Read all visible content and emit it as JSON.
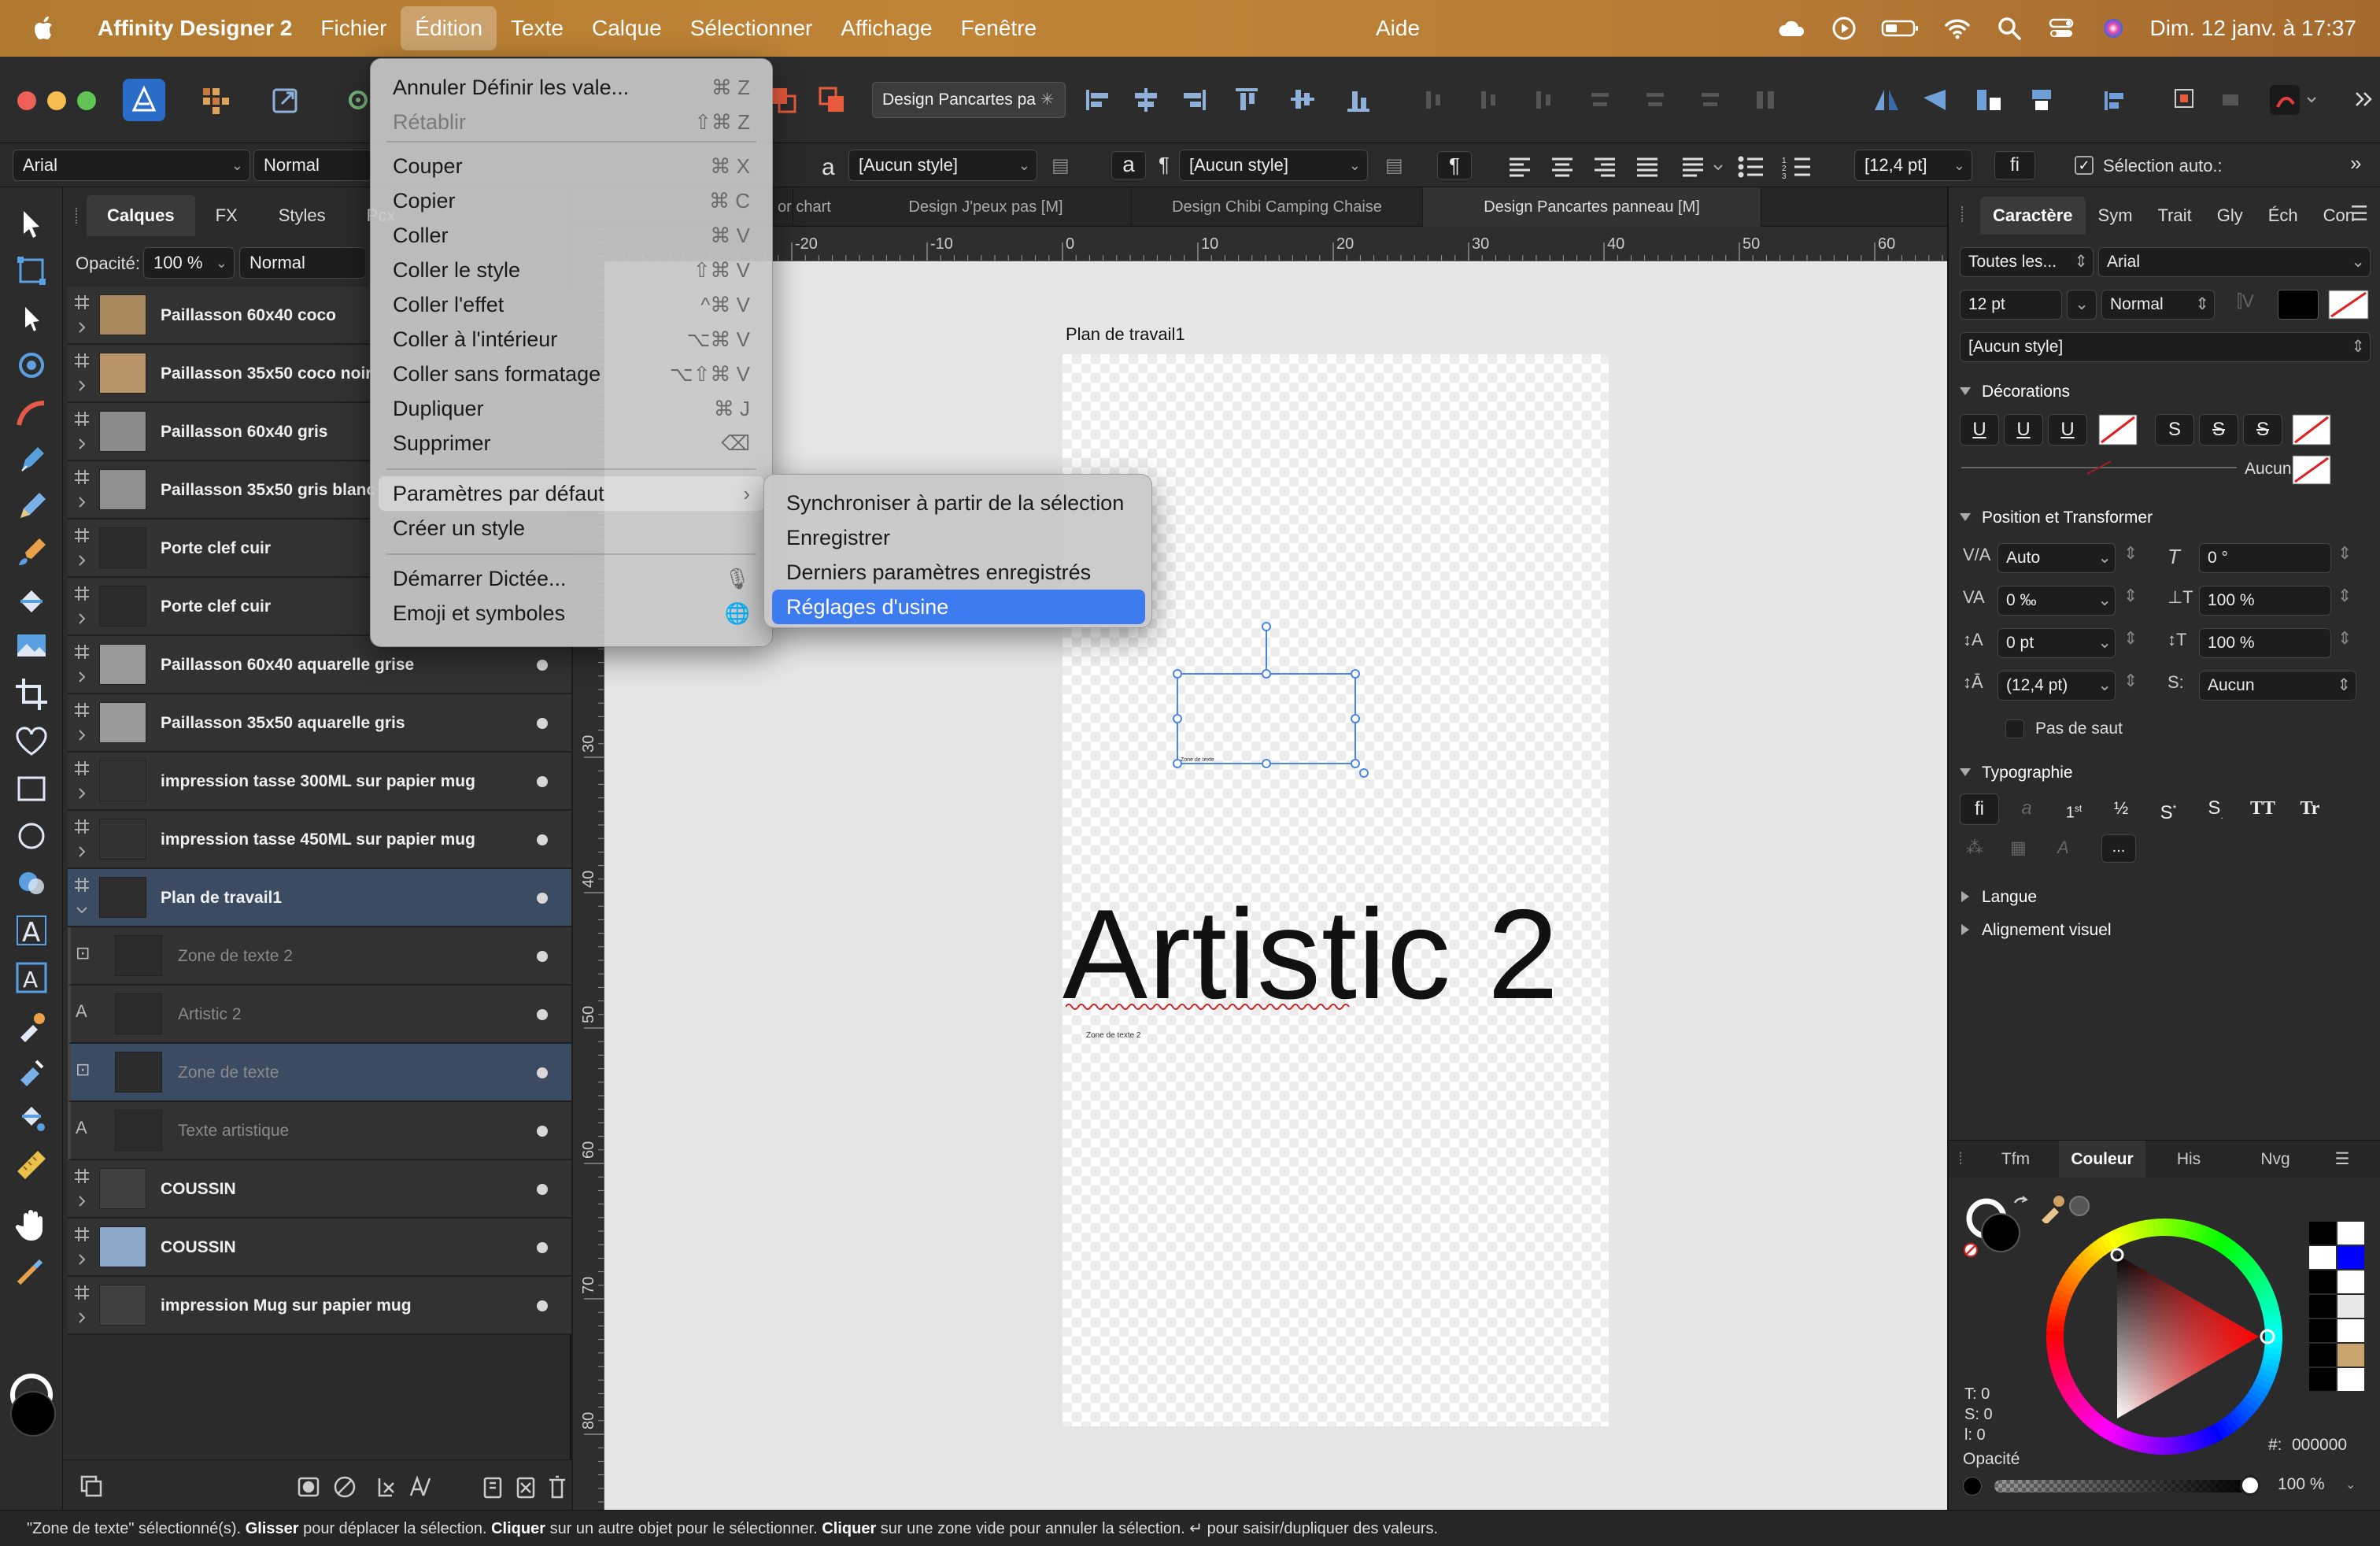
{
  "menubar": {
    "app_name": "Affinity Designer 2",
    "items": [
      "Fichier",
      "Édition",
      "Texte",
      "Calque",
      "Sélectionner",
      "Affichage",
      "Fenêtre"
    ],
    "help": "Aide",
    "datetime": "Dim. 12 janv. à 17:37"
  },
  "toolbar": {
    "doc_name": "Design Pancartes pa",
    "font_family": "Arial",
    "font_style": "Normal",
    "char_style": "[Aucun style]",
    "para_style": "[Aucun style]",
    "leading": "[12,4 pt]",
    "auto_select": "Sélection auto.:"
  },
  "layers_panel": {
    "tabs": [
      "Calques",
      "FX",
      "Styles",
      "Pcx"
    ],
    "opacity_label": "Opacité:",
    "opacity_value": "100 %",
    "blend_mode": "Normal",
    "rows": [
      {
        "name": "Paillasson 60x40 coco"
      },
      {
        "name": "Paillasson 35x50 coco noir"
      },
      {
        "name": "Paillasson 60x40 gris"
      },
      {
        "name": "Paillasson 35x50 gris blanc"
      },
      {
        "name": "Porte clef cuir"
      },
      {
        "name": "Porte clef cuir"
      },
      {
        "name": "Paillasson 60x40 aquarelle grise"
      },
      {
        "name": "Paillasson 35x50 aquarelle gris"
      },
      {
        "name": "impression tasse 300ML sur papier mug"
      },
      {
        "name": "impression tasse 450ML sur papier mug"
      },
      {
        "name": "Plan de travail1"
      },
      {
        "name": "Zone de texte 2"
      },
      {
        "name": "Artistic 2"
      },
      {
        "name": "Zone de texte"
      },
      {
        "name": "Texte artistique"
      },
      {
        "name": "COUSSIN"
      },
      {
        "name": "COUSSIN"
      },
      {
        "name": "impression Mug sur papier mug"
      }
    ]
  },
  "doc_tabs": [
    "or chart",
    "Design J'peux pas [M]",
    "Design Chibi Camping Chaise",
    "Design Pancartes  panneau [M]"
  ],
  "ruler_top": [
    "-20",
    "-10",
    "0",
    "10",
    "20",
    "30",
    "40",
    "50",
    "60"
  ],
  "ruler_left": [
    "30",
    "40",
    "50",
    "60",
    "70",
    "80"
  ],
  "canvas": {
    "artboard_label": "Plan de travail1",
    "artistic_text": "Artistic 2",
    "small_text_1": "Zone de texte",
    "small_text_2": "Zone de texte 2"
  },
  "edit_menu": {
    "items": [
      {
        "label": "Annuler Définir les vale...",
        "shortcut": "⌘ Z"
      },
      {
        "label": "Rétablir",
        "shortcut": "⇧⌘ Z"
      },
      {
        "label": "Couper",
        "shortcut": "⌘ X"
      },
      {
        "label": "Copier",
        "shortcut": "⌘ C"
      },
      {
        "label": "Coller",
        "shortcut": "⌘ V"
      },
      {
        "label": "Coller le style",
        "shortcut": "⇧⌘ V"
      },
      {
        "label": "Coller l'effet",
        "shortcut": "^⌘ V"
      },
      {
        "label": "Coller à l'intérieur",
        "shortcut": "⌥⌘ V"
      },
      {
        "label": "Coller sans formatage",
        "shortcut": "⌥⇧⌘ V"
      },
      {
        "label": "Dupliquer",
        "shortcut": "⌘ J"
      },
      {
        "label": "Supprimer",
        "shortcut": "⌫"
      },
      {
        "label": "Paramètres par défaut",
        "shortcut": "›"
      },
      {
        "label": "Créer un style",
        "shortcut": ""
      },
      {
        "label": "Démarrer Dictée...",
        "shortcut": "🎙"
      },
      {
        "label": "Emoji et symboles",
        "shortcut": "🌐"
      }
    ]
  },
  "submenu": {
    "items": [
      "Synchroniser à partir de la sélection",
      "Enregistrer",
      "Derniers paramètres enregistrés",
      "Réglages d'usine"
    ]
  },
  "char_panel": {
    "tabs": [
      "Caractère",
      "Sym",
      "Trait",
      "Gly",
      "Éch",
      "Con"
    ],
    "font_collection": "Toutes les...",
    "font_family": "Arial",
    "font_size": "12 pt",
    "font_style": "Normal",
    "char_style": "[Aucun style]",
    "sec_decorations": "Décorations",
    "decoration_none": "Aucun",
    "sec_position": "Position et Transformer",
    "kerning": "Auto",
    "tracking": "0 ‰",
    "baseline": "0 pt",
    "leading": "(12,4 pt)",
    "shear": "0 °",
    "hscale": "100 %",
    "vscale": "100 %",
    "no_break_style": "Aucun",
    "no_break": "Pas de saut",
    "sec_typography": "Typographie",
    "sec_language": "Langue",
    "sec_visual_align": "Alignement visuel"
  },
  "color_panel": {
    "tabs": [
      "Tfm",
      "Couleur",
      "His",
      "Nvg"
    ],
    "hsl": [
      "T: 0",
      "S: 0",
      "l: 0"
    ],
    "hex_label": "#:",
    "hex_value": "000000",
    "opacity_label": "Opacité",
    "opacity_value": "100 %",
    "swatches": [
      "#000000",
      "#ffffff",
      "#ffffff",
      "#0000ff",
      "#000000",
      "#ffffff",
      "#000000",
      "#e8e8e8",
      "#000000",
      "#ffffff",
      "#000000",
      "#c9a46e",
      "#000000",
      "#ffffff"
    ]
  },
  "status_bar": {
    "p1": "\"Zone de texte\" sélectionné(s). ",
    "b1": "Glisser",
    "p2": " pour déplacer la sélection. ",
    "b2": "Cliquer",
    "p3": " sur un autre objet pour le sélectionner. ",
    "b3": "Cliquer",
    "p4": " sur une zone vide pour annuler la sélection. ↵ pour saisir/dupliquer des valeurs."
  },
  "colors": {
    "menubar_accent": "#b87c36",
    "selection_blue": "#3d7bf0",
    "layer_selected": "#3b4b62"
  }
}
